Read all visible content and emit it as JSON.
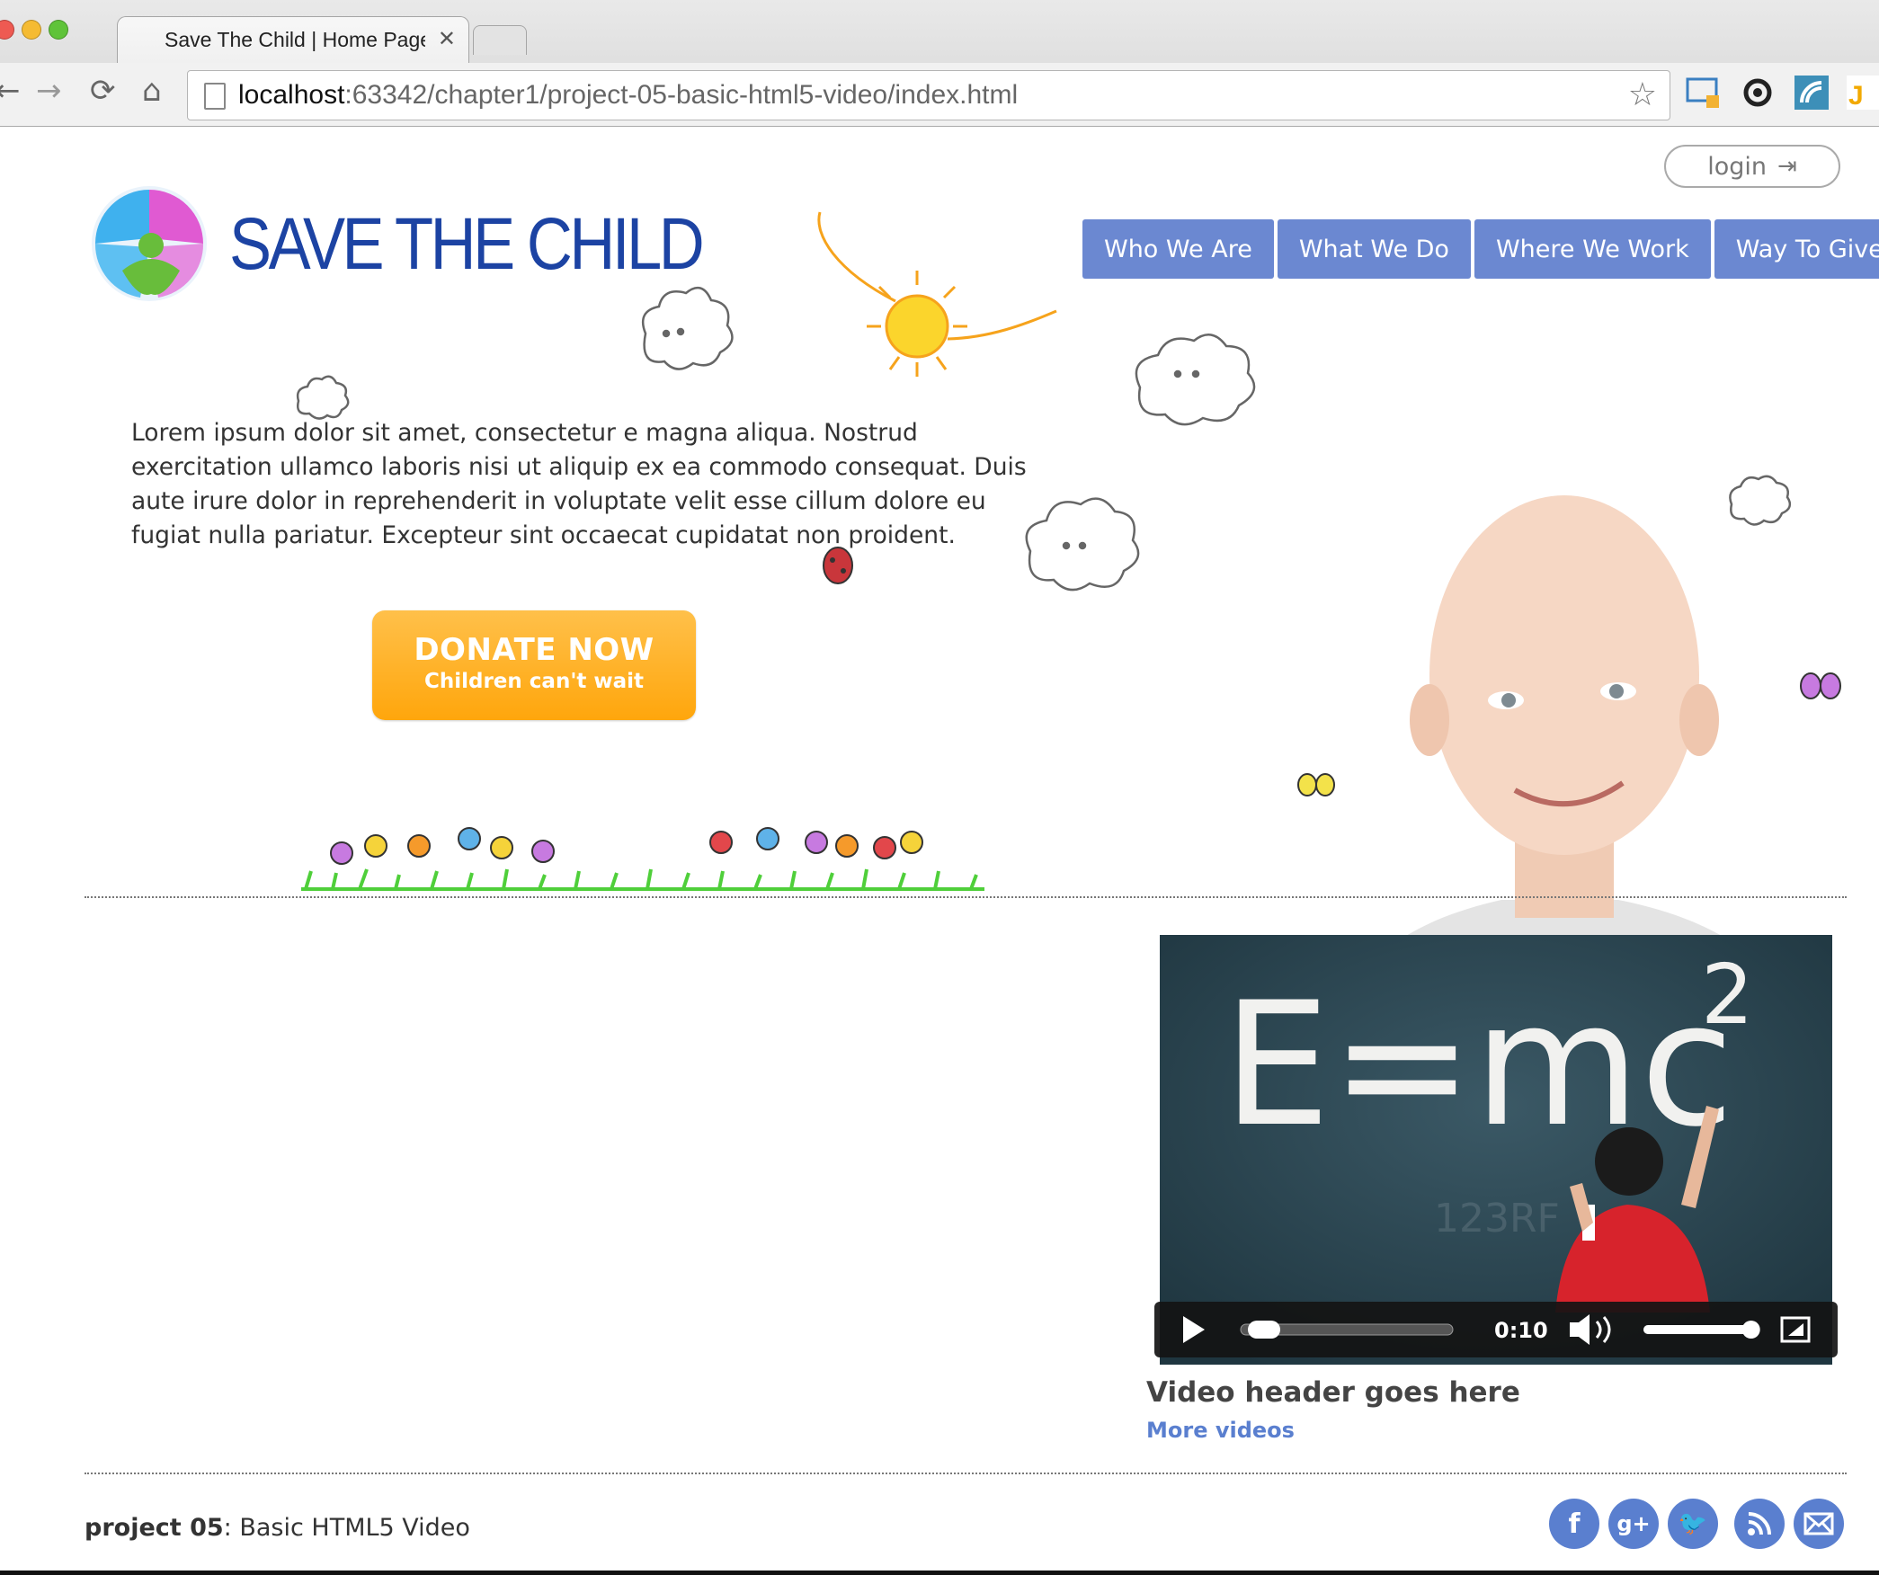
{
  "browser": {
    "tab_title": "Save The Child | Home Page",
    "tab_close": "✕",
    "url_host": "localhost",
    "url_path": ":63342/chapter1/project-05-basic-html5-video/index.html"
  },
  "header": {
    "login_label": "login",
    "logo_text": "SAVE THE CHILD",
    "nav": [
      "Who We Are",
      "What We Do",
      "Where We Work",
      "Way To Give"
    ]
  },
  "main": {
    "intro": "Lorem ipsum dolor sit amet, consectetur e magna aliqua. Nostrud exercitation ullamco laboris nisi ut aliquip ex ea commodo consequat. Duis aute irure dolor in reprehenderit in voluptate velit esse cillum dolore eu fugiat nulla pariatur. Excepteur sint occaecat cupidatat non proident.",
    "donate_main": "DONATE NOW",
    "donate_sub": "Children can't wait"
  },
  "video": {
    "chalk_text": "E=mc",
    "chalk_sup": "2",
    "watermark": "123RF",
    "time": "0:10",
    "progress": 0.04,
    "volume": 0.95,
    "header": "Video header goes here",
    "more_link": "More videos"
  },
  "footer": {
    "label_bold": "project 05",
    "label_rest": ": Basic HTML5 Video",
    "social_icons": [
      "facebook-icon",
      "google-plus-icon",
      "twitter-icon",
      "rss-icon",
      "email-icon"
    ]
  },
  "colors": {
    "brand_blue": "#1c43a3",
    "nav_blue": "#6b88d1",
    "donate_orange": "#ffa60c",
    "link_blue": "#5a7fcf"
  }
}
